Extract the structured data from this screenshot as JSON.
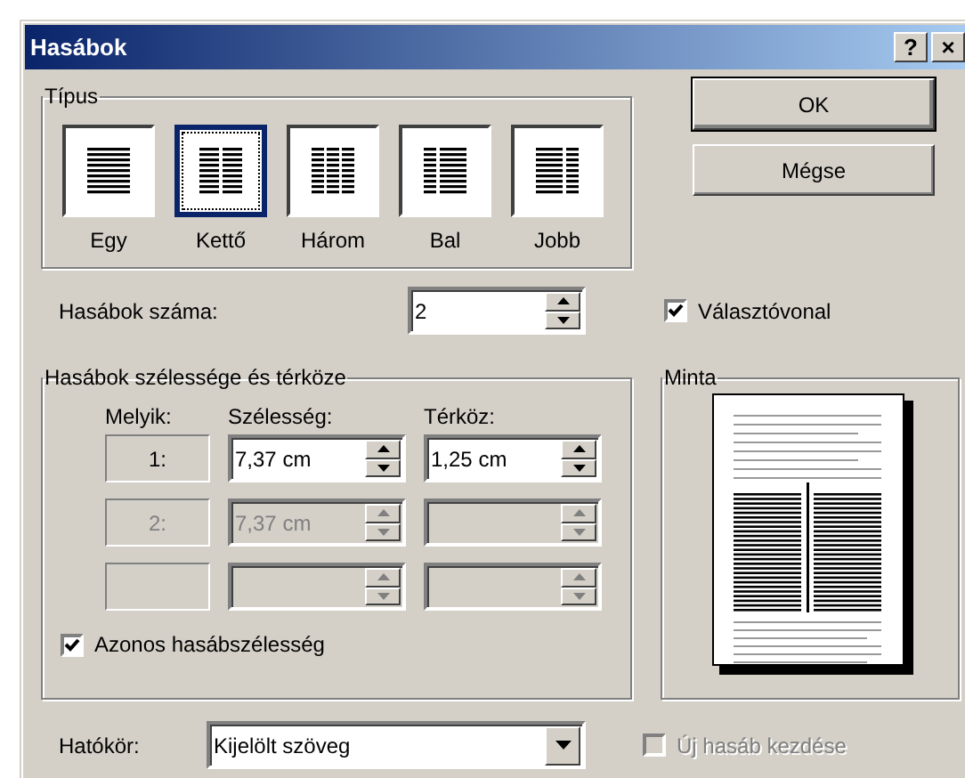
{
  "window": {
    "title": "Hasábok",
    "help": "?",
    "close": "×"
  },
  "type_group": {
    "label": "Típus",
    "options": [
      {
        "label": "Egy",
        "kind": "one",
        "selected": false
      },
      {
        "label": "Kettő",
        "kind": "two",
        "selected": true
      },
      {
        "label": "Három",
        "kind": "three",
        "selected": false
      },
      {
        "label": "Bal",
        "kind": "left",
        "selected": false
      },
      {
        "label": "Jobb",
        "kind": "right",
        "selected": false
      }
    ]
  },
  "buttons": [
    {
      "label": "OK",
      "default": true
    },
    {
      "label": "Mégse",
      "default": false
    }
  ],
  "column_count": {
    "label": "Hasábok száma:",
    "value": "2"
  },
  "separator_line": {
    "label": "Választóvonal",
    "checked": true
  },
  "width_spacing": {
    "label": "Hasábok szélessége és térköze",
    "headers": [
      "Melyik:",
      "Szélesség:",
      "Térköz:"
    ],
    "rows": [
      {
        "index": "1:",
        "width": "7,37 cm",
        "spacing": "1,25 cm",
        "disabled": false
      },
      {
        "index": "2:",
        "width": "7,37 cm",
        "disabled": true
      },
      {
        "disabled": true
      }
    ]
  },
  "equal_width": {
    "label": "Azonos hasábszélesség",
    "checked": true
  },
  "preview": {
    "label": "Minta"
  },
  "apply_to": {
    "label": "Hatókör:",
    "value": "Kijelölt szöveg"
  },
  "new_column": {
    "label": "Új hasáb kezdése",
    "checked": false,
    "disabled": true
  }
}
